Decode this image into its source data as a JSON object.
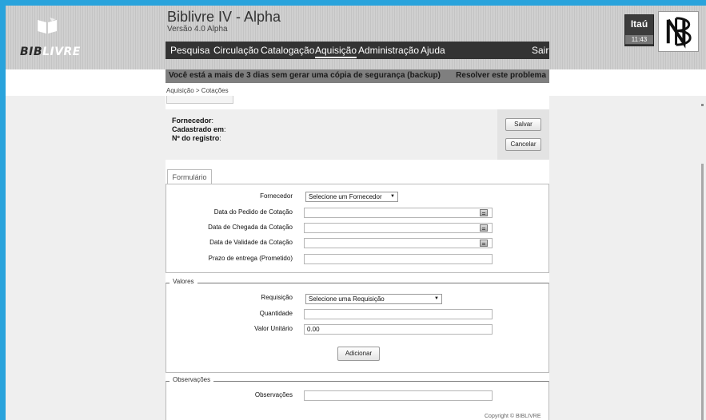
{
  "app": {
    "logo_bib": "BIB",
    "logo_livre": "LIVRE",
    "title": "Biblivre IV - Alpha",
    "version": "Versão 4.0 Alpha"
  },
  "menu": {
    "items": [
      "Pesquisa",
      "Circulação",
      "Catalogação",
      "Aquisição",
      "Administração",
      "Ajuda"
    ],
    "active": "Aquisição",
    "logout": "Sair"
  },
  "user": {
    "name": "Itaú",
    "time": "11:43"
  },
  "warning": {
    "text": "Você está a mais de 3 dias sem gerar uma cópia de segurança (backup)",
    "link": "Resolver este problema"
  },
  "breadcrumb": "Aquisição > Cotações",
  "record": {
    "fornecedor_label": "Fornecedor",
    "cadastrado_label": "Cadastrado em",
    "registro_label": "Nº do registro",
    "save": "Salvar",
    "cancel": "Cancelar"
  },
  "form": {
    "tab": "Formulário",
    "fornecedor_label": "Fornecedor",
    "fornecedor_select": "Selecione um Fornecedor",
    "pedido_label": "Data do Pedido de Cotação",
    "chegada_label": "Data de Chegada da Cotação",
    "validade_label": "Data de Validade da Cotação",
    "prazo_label": "Prazo de entrega (Prometido)"
  },
  "valores": {
    "legend": "Valores",
    "requisicao_label": "Requisição",
    "requisicao_select": "Selecione uma Requisição",
    "quantidade_label": "Quantidade",
    "valor_label": "Valor Unitário",
    "valor_value": "0.00",
    "add": "Adicionar"
  },
  "observacoes": {
    "legend": "Observações",
    "label": "Observações"
  },
  "footer": {
    "copyright": "Copyright © BIBLIVRE"
  }
}
